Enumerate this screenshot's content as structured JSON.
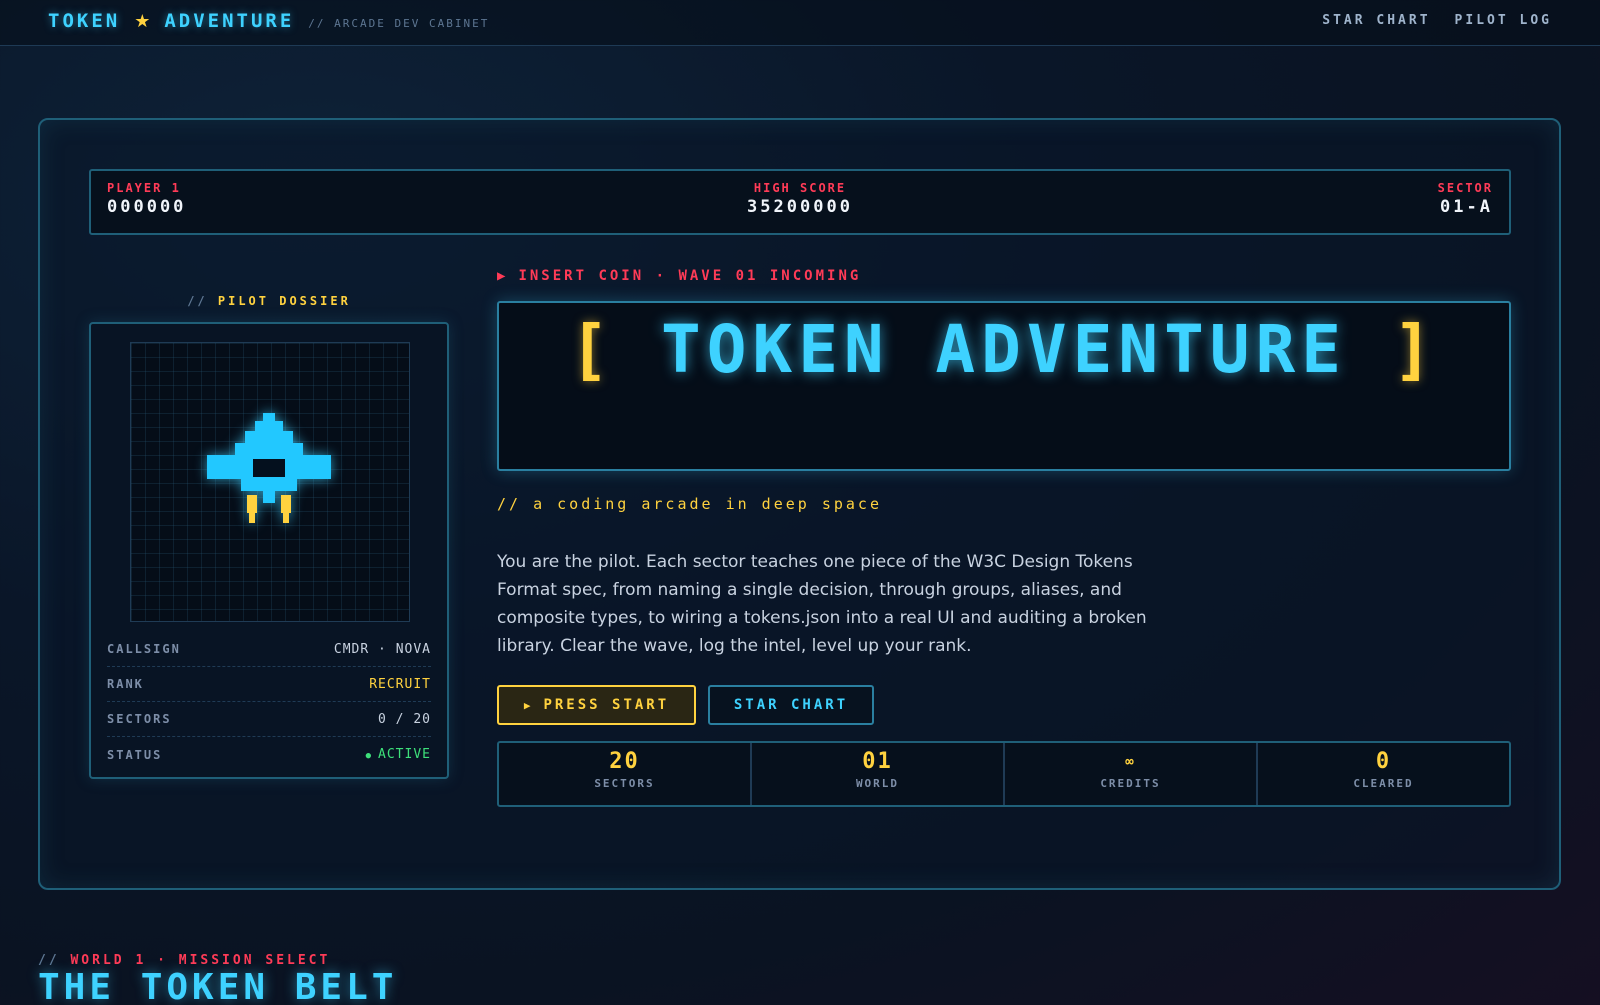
{
  "nav": {
    "brand_word_1": "TOKEN",
    "brand_star": "★",
    "brand_word_2": "ADVENTURE",
    "brand_sub": "// ARCADE DEV CABINET",
    "links": [
      "STAR CHART",
      "PILOT LOG"
    ]
  },
  "scoreboard": {
    "player_label": "PLAYER 1",
    "player_score": "000000",
    "high_label": "HIGH SCORE",
    "high_score": "35200000",
    "sector_label": "SECTOR",
    "sector_value": "01-A"
  },
  "dossier": {
    "title_prefix": "//",
    "title": "PILOT DOSSIER",
    "stats": [
      {
        "key": "CALLSIGN",
        "value": "CMDR · NOVA"
      },
      {
        "key": "RANK",
        "value": "RECRUIT"
      },
      {
        "key": "SECTORS",
        "value": "0 / 20"
      },
      {
        "key": "STATUS",
        "value": "ACTIVE",
        "indicator": "●"
      }
    ]
  },
  "hero": {
    "wave_arrow": "▶",
    "wave_text": "INSERT COIN · WAVE 01 INCOMING",
    "bracket_open": "[",
    "title": "TOKEN ADVENTURE",
    "bracket_close": "]",
    "tagline": "// a coding arcade in deep space",
    "intro": "You are the pilot. Each sector teaches one piece of the W3C Design Tokens Format spec, from naming a single decision, through groups, aliases, and composite types, to wiring a tokens.json into a real UI and auditing a broken library. Clear the wave, log the intel, level up your rank.",
    "press_start_icon": "▶",
    "press_start": "PRESS START",
    "star_chart": "STAR CHART"
  },
  "counters": [
    {
      "value": "20",
      "label": "SECTORS"
    },
    {
      "value": "01",
      "label": "WORLD"
    },
    {
      "value": "∞",
      "label": "CREDITS"
    },
    {
      "value": "0",
      "label": "CLEARED"
    }
  ],
  "world": {
    "kicker_prefix": "//",
    "kicker": "WORLD 1 · MISSION SELECT",
    "title": "THE TOKEN BELT"
  },
  "colors": {
    "cyan": "#3ed2ff",
    "yellow": "#ffd23f",
    "red": "#ff3b57",
    "green": "#3ee07a",
    "frame": "#1f5f78"
  }
}
